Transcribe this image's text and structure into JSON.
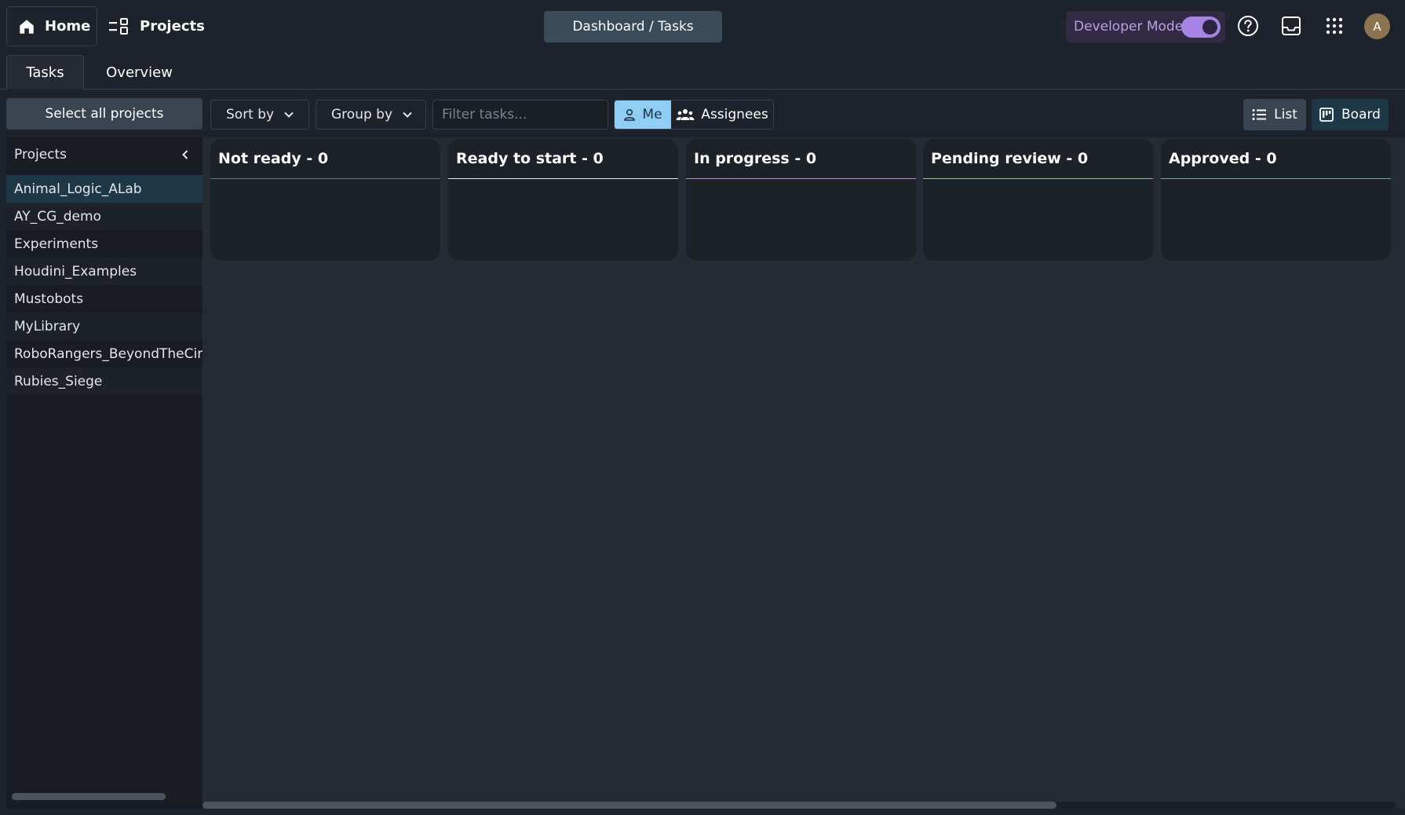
{
  "topbar": {
    "home_label": "Home",
    "home_icon": "home-icon",
    "projects_label": "Projects",
    "projects_icon": "projects-icon",
    "breadcrumb": "Dashboard / Tasks",
    "developer_mode_label": "Developer Mode",
    "developer_mode_on": true,
    "help_icon": "help-icon",
    "inbox_icon": "inbox-icon",
    "apps_icon": "apps-grid-icon",
    "avatar_initial": "A"
  },
  "tabs": [
    {
      "label": "Tasks",
      "active": true
    },
    {
      "label": "Overview",
      "active": false
    }
  ],
  "toolbar": {
    "select_all_label": "Select all projects",
    "sort_label": "Sort by",
    "group_label": "Group by",
    "filter_placeholder": "Filter tasks...",
    "me_label": "Me",
    "assignees_label": "Assignees",
    "list_label": "List",
    "board_label": "Board",
    "active_view": "Board"
  },
  "sidebar": {
    "title": "Projects",
    "items": [
      {
        "label": "Animal_Logic_ALab",
        "selected": true
      },
      {
        "label": "AY_CG_demo"
      },
      {
        "label": "Experiments"
      },
      {
        "label": "Houdini_Examples"
      },
      {
        "label": "Mustobots"
      },
      {
        "label": "MyLibrary"
      },
      {
        "label": "RoboRangers_BeyondTheCirc"
      },
      {
        "label": "Rubies_Siege"
      }
    ]
  },
  "board": {
    "columns": [
      {
        "label": "Not ready - 0",
        "accent": "#6b7079"
      },
      {
        "label": "Ready to start - 0",
        "accent": "#e8e8e8"
      },
      {
        "label": "In progress - 0",
        "accent": "#5fb6d6"
      },
      {
        "label": "Pending review - 0",
        "accent": "#e6a93a"
      },
      {
        "label": "Approved - 0",
        "accent": "#3cc9a8"
      }
    ]
  },
  "colors": {
    "background": "#1e222a",
    "board_bg": "#252a33",
    "accent_blue": "#90cdf4",
    "accent_purple": "#a584e6"
  }
}
